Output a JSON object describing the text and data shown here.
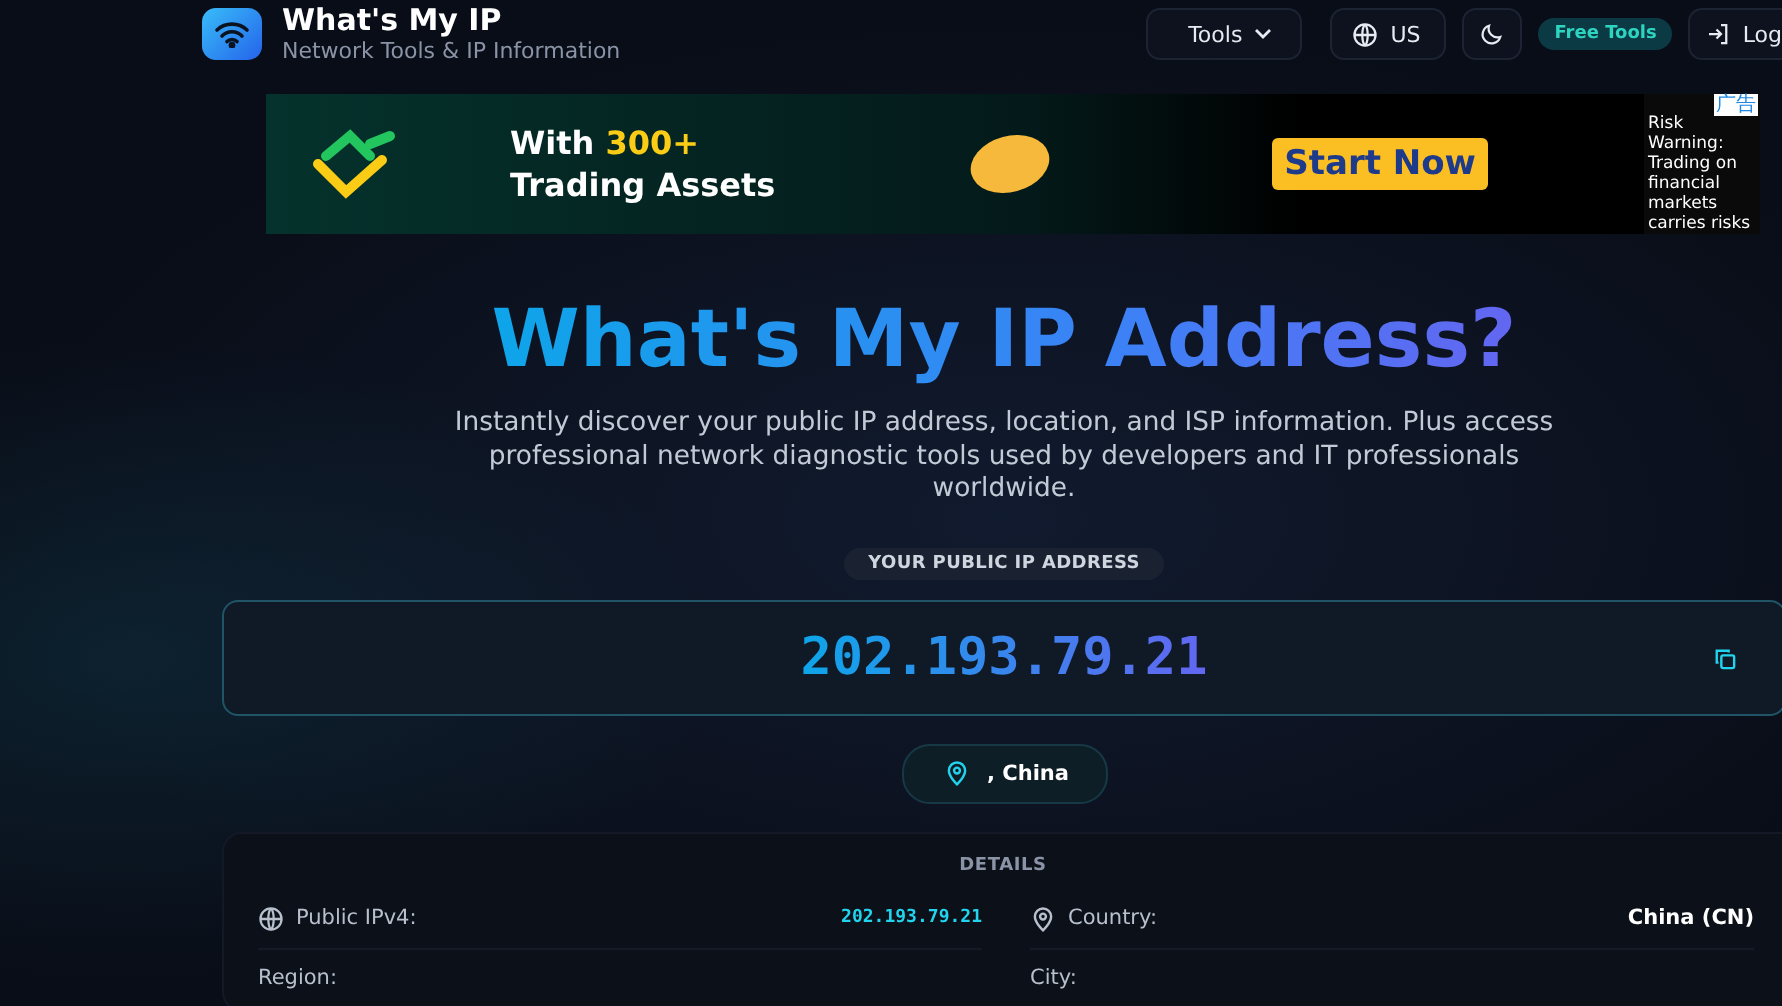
{
  "header": {
    "title": "What's My IP",
    "subtitle": "Network Tools & IP Information",
    "nav": [
      {
        "kind": "menu",
        "label": "Tools"
      },
      {
        "kind": "language",
        "label": "US"
      },
      {
        "kind": "theme"
      },
      {
        "kind": "badge",
        "label": "Free Tools"
      },
      {
        "kind": "login",
        "label": "Log"
      }
    ]
  },
  "ad": {
    "tag": "广告",
    "headline": "With **300+** Trading Assets",
    "cta": "Start Now",
    "disclaimer": "Risk Warning: Trading on financial markets carries risks"
  },
  "hero": {
    "title": "What's My IP Address?",
    "description": "Instantly discover your public IP address, location, and ISP information. Plus access professional network diagnostic tools used by developers and IT professionals worldwide.",
    "ip_label": "YOUR PUBLIC IP ADDRESS",
    "ip": "202.193.79.21",
    "location": ", China"
  },
  "details": {
    "title": "DETAILS",
    "rows": [
      {
        "kind": "ip",
        "label": "Public IPv4:",
        "value": "202.193.79.21"
      },
      {
        "kind": "country",
        "label": "Country:",
        "value": "China (CN)"
      },
      {
        "kind": "plain",
        "label": "Region:"
      },
      {
        "kind": "plain",
        "label": "City:"
      }
    ]
  }
}
